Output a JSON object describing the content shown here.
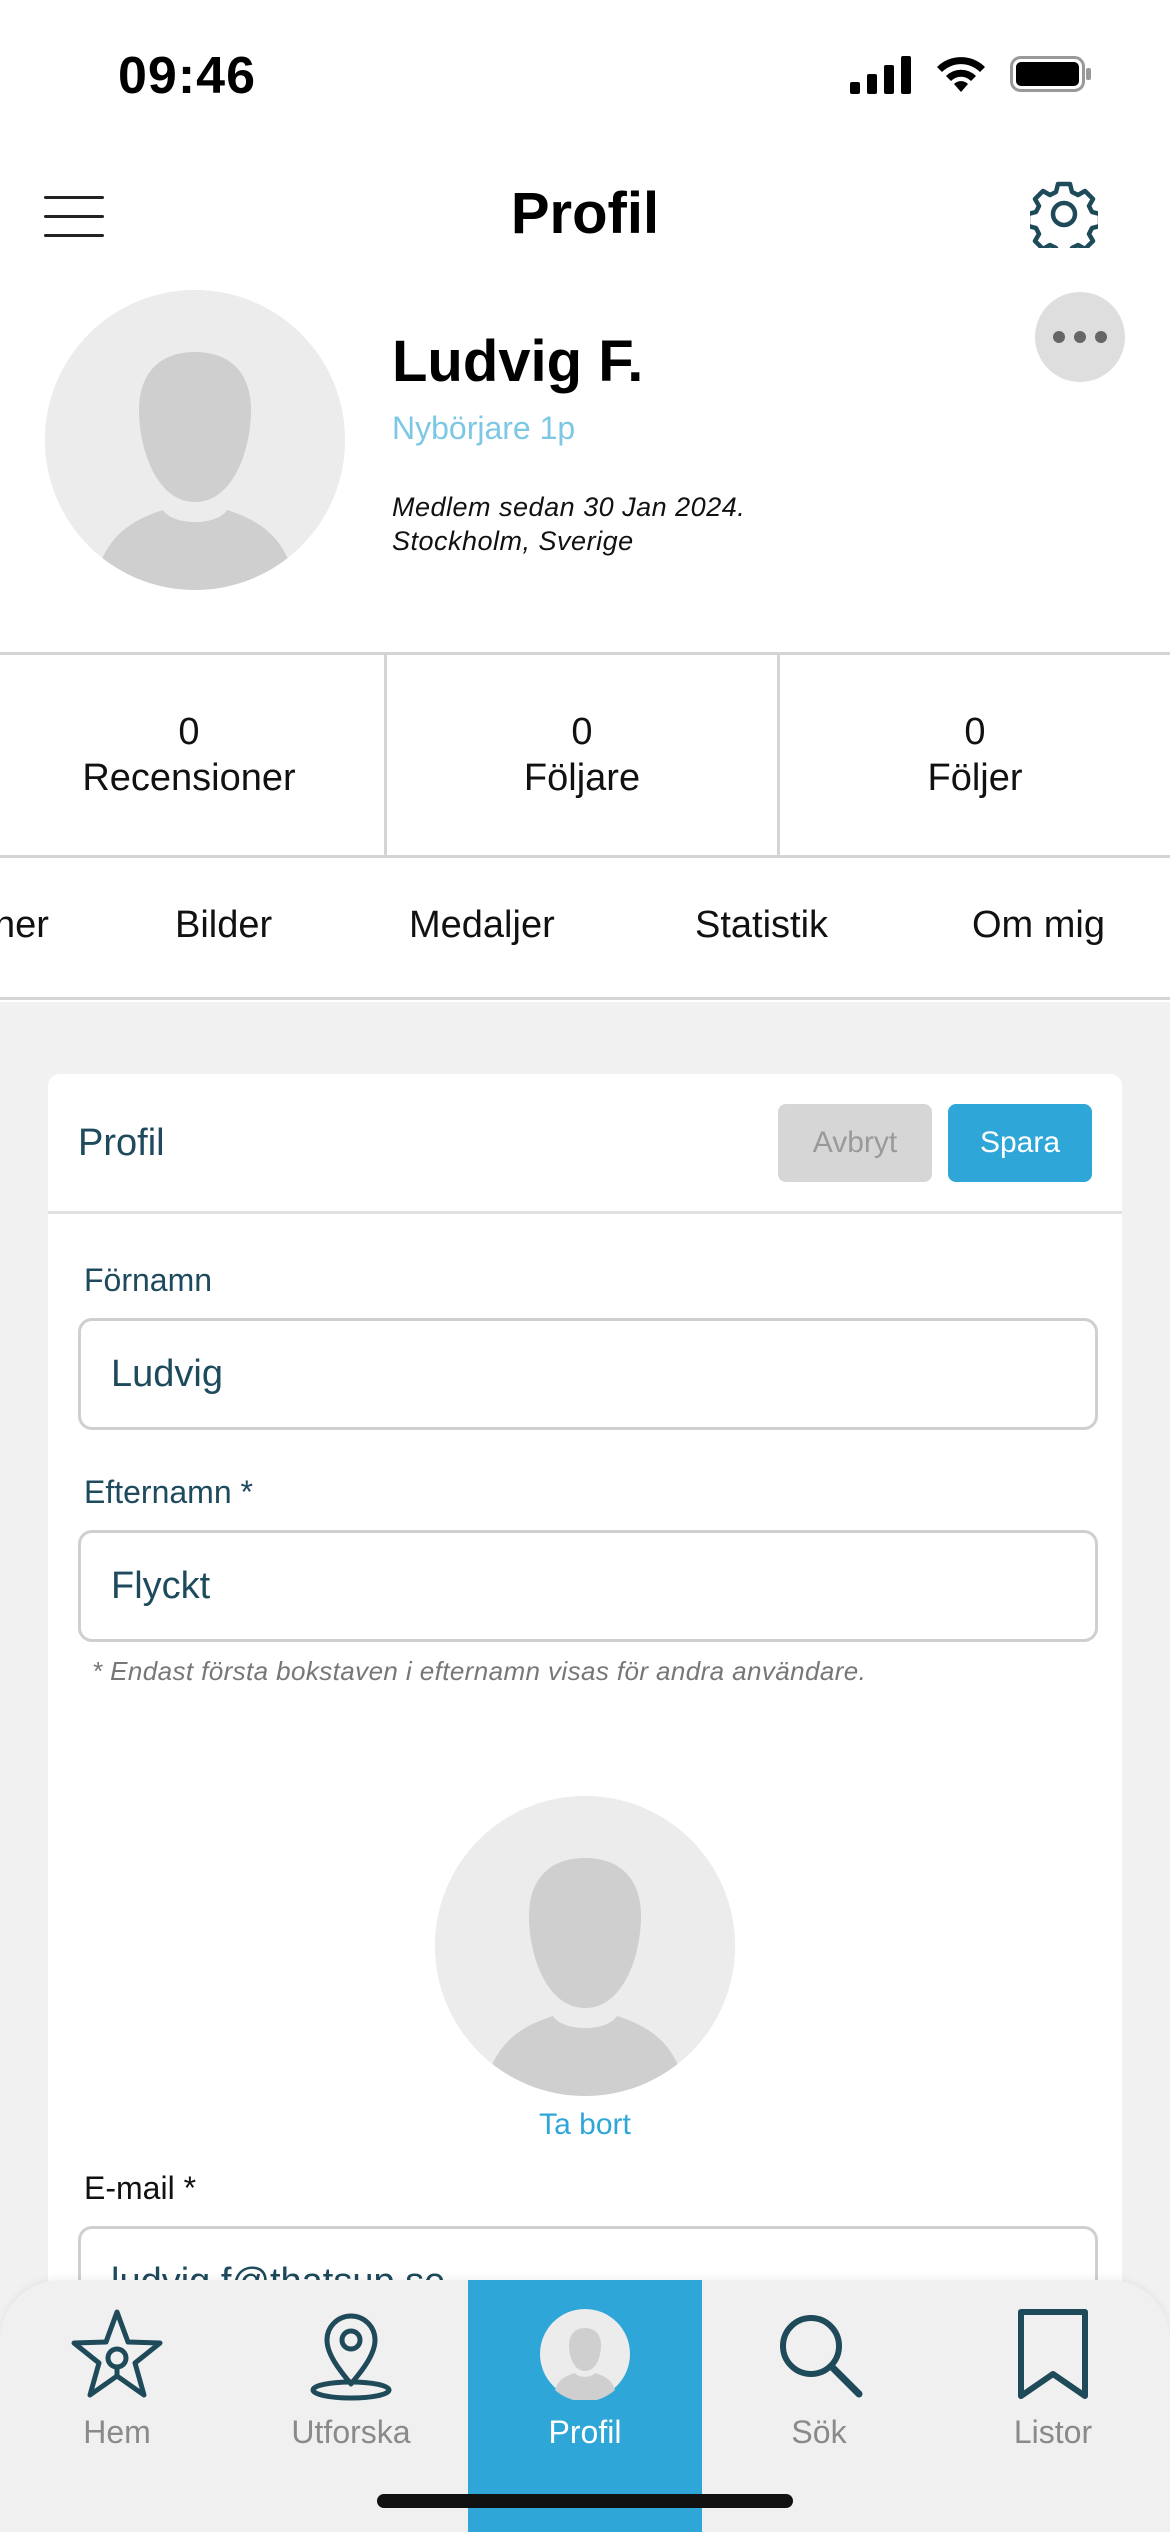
{
  "status_bar": {
    "time": "09:46"
  },
  "header": {
    "title": "Profil"
  },
  "profile": {
    "name": "Ludvig F.",
    "level": "Nybörjare 1p",
    "member_since": "Medlem sedan 30 Jan 2024.",
    "location": "Stockholm, Sverige"
  },
  "stats": [
    {
      "count": "0",
      "label": "Recensioner"
    },
    {
      "count": "0",
      "label": "Följare"
    },
    {
      "count": "0",
      "label": "Följer"
    }
  ],
  "tabs": [
    "ner",
    "Bilder",
    "Medaljer",
    "Statistik",
    "Om mig"
  ],
  "card": {
    "title": "Profil",
    "cancel_label": "Avbryt",
    "save_label": "Spara",
    "first_name_label": "Förnamn",
    "first_name_value": "Ludvig",
    "last_name_label": "Efternamn *",
    "last_name_value": "Flyckt",
    "last_name_note": "* Endast första bokstaven i efternamn visas för andra användare.",
    "remove_photo": "Ta bort",
    "email_label": "E-mail *",
    "email_value": "ludvig.f@thatsup.se"
  },
  "nav": [
    {
      "label": "Hem",
      "icon": "star-pin-icon"
    },
    {
      "label": "Utforska",
      "icon": "map-pin-icon"
    },
    {
      "label": "Profil",
      "icon": "avatar-icon",
      "active": true
    },
    {
      "label": "Sök",
      "icon": "search-icon"
    },
    {
      "label": "Listor",
      "icon": "bookmark-icon"
    }
  ],
  "colors": {
    "accent": "#2fa6d8",
    "level_text": "#7cc8e4",
    "dark_teal": "#1d4a5c",
    "nav_icon": "#1f4a5a"
  }
}
